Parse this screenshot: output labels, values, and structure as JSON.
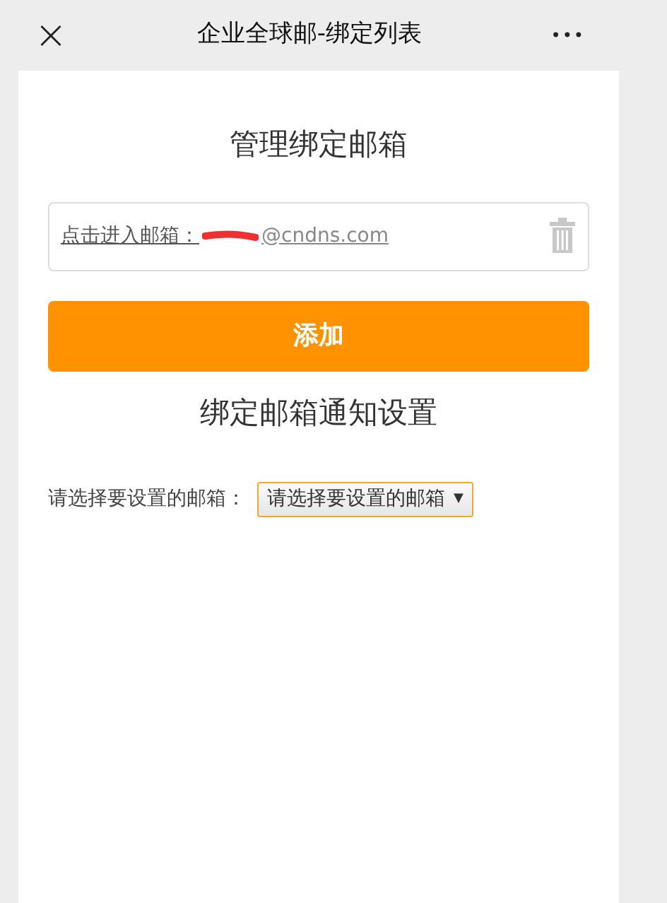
{
  "header": {
    "close": "×",
    "title": "企业全球邮-绑定列表",
    "more": "•••"
  },
  "section_title": "管理绑定邮箱",
  "bound_mailboxes": [
    {
      "link": "点击进入邮箱：",
      "email": "@cndns.com"
    }
  ],
  "add_button": "添加",
  "notify_title": "绑定邮箱通知设置",
  "select_row": {
    "label": "请选择要设置的邮箱：",
    "value": "请选择要设置的邮箱",
    "arrow": "▼"
  }
}
